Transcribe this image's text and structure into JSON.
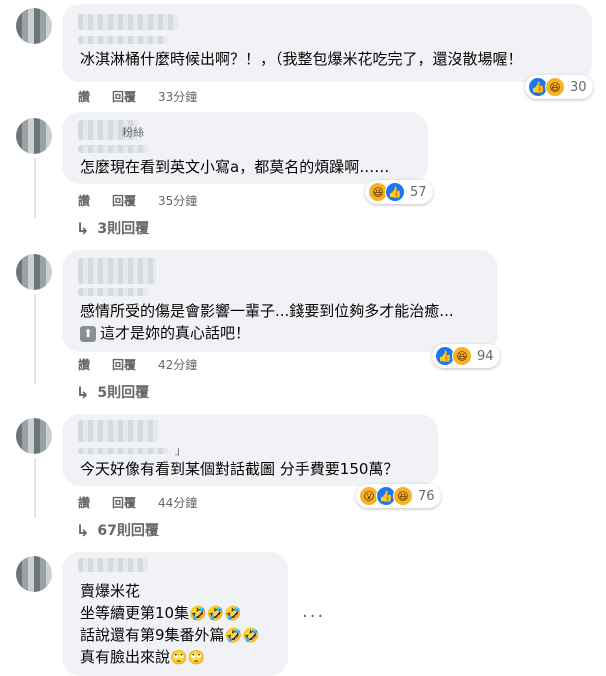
{
  "comments": [
    {
      "text_lines": [
        "冰淇淋桶什麼時候出啊？！，（我整包爆米花吃完了，還沒散場喔！"
      ],
      "like_label": "讚",
      "reply_label": "回覆",
      "time": "33分鐘",
      "reaction_count": "30",
      "reaction_icons": [
        "like-icon",
        "haha-icon"
      ]
    },
    {
      "tag": "粉絲",
      "text_lines": [
        "怎麼現在看到英文小寫a，都莫名的煩躁啊……"
      ],
      "like_label": "讚",
      "reply_label": "回覆",
      "time": "35分鐘",
      "reaction_count": "57",
      "reaction_icons": [
        "haha-icon",
        "like-icon"
      ],
      "replies_label": "3則回覆"
    },
    {
      "text_lines": [
        "感情所受的傷是會影響一輩子...錢要到位夠多才能治癒...",
        "這才是妳的真心話吧！"
      ],
      "like_label": "讚",
      "reply_label": "回覆",
      "time": "42分鐘",
      "reaction_count": "94",
      "reaction_icons": [
        "like-icon",
        "haha-icon"
      ],
      "replies_label": "5則回覆"
    },
    {
      "tag": "」",
      "text_lines": [
        "今天好像有看到某個對話截圖 分手費要150萬？"
      ],
      "like_label": "讚",
      "reply_label": "回覆",
      "time": "44分鐘",
      "reaction_count": "76",
      "reaction_icons": [
        "wow-icon",
        "like-icon",
        "haha-icon"
      ],
      "replies_label": "67則回覆"
    },
    {
      "text_lines": [
        "賣爆米花",
        "坐等續更第10集",
        "話說還有第9集番外篇",
        "真有臉出來說"
      ],
      "more_label": "···"
    }
  ],
  "colors": {
    "like": "#1877f2",
    "haha": "#f7b125",
    "bubble": "#f0f2f5",
    "meta": "#65676b"
  }
}
